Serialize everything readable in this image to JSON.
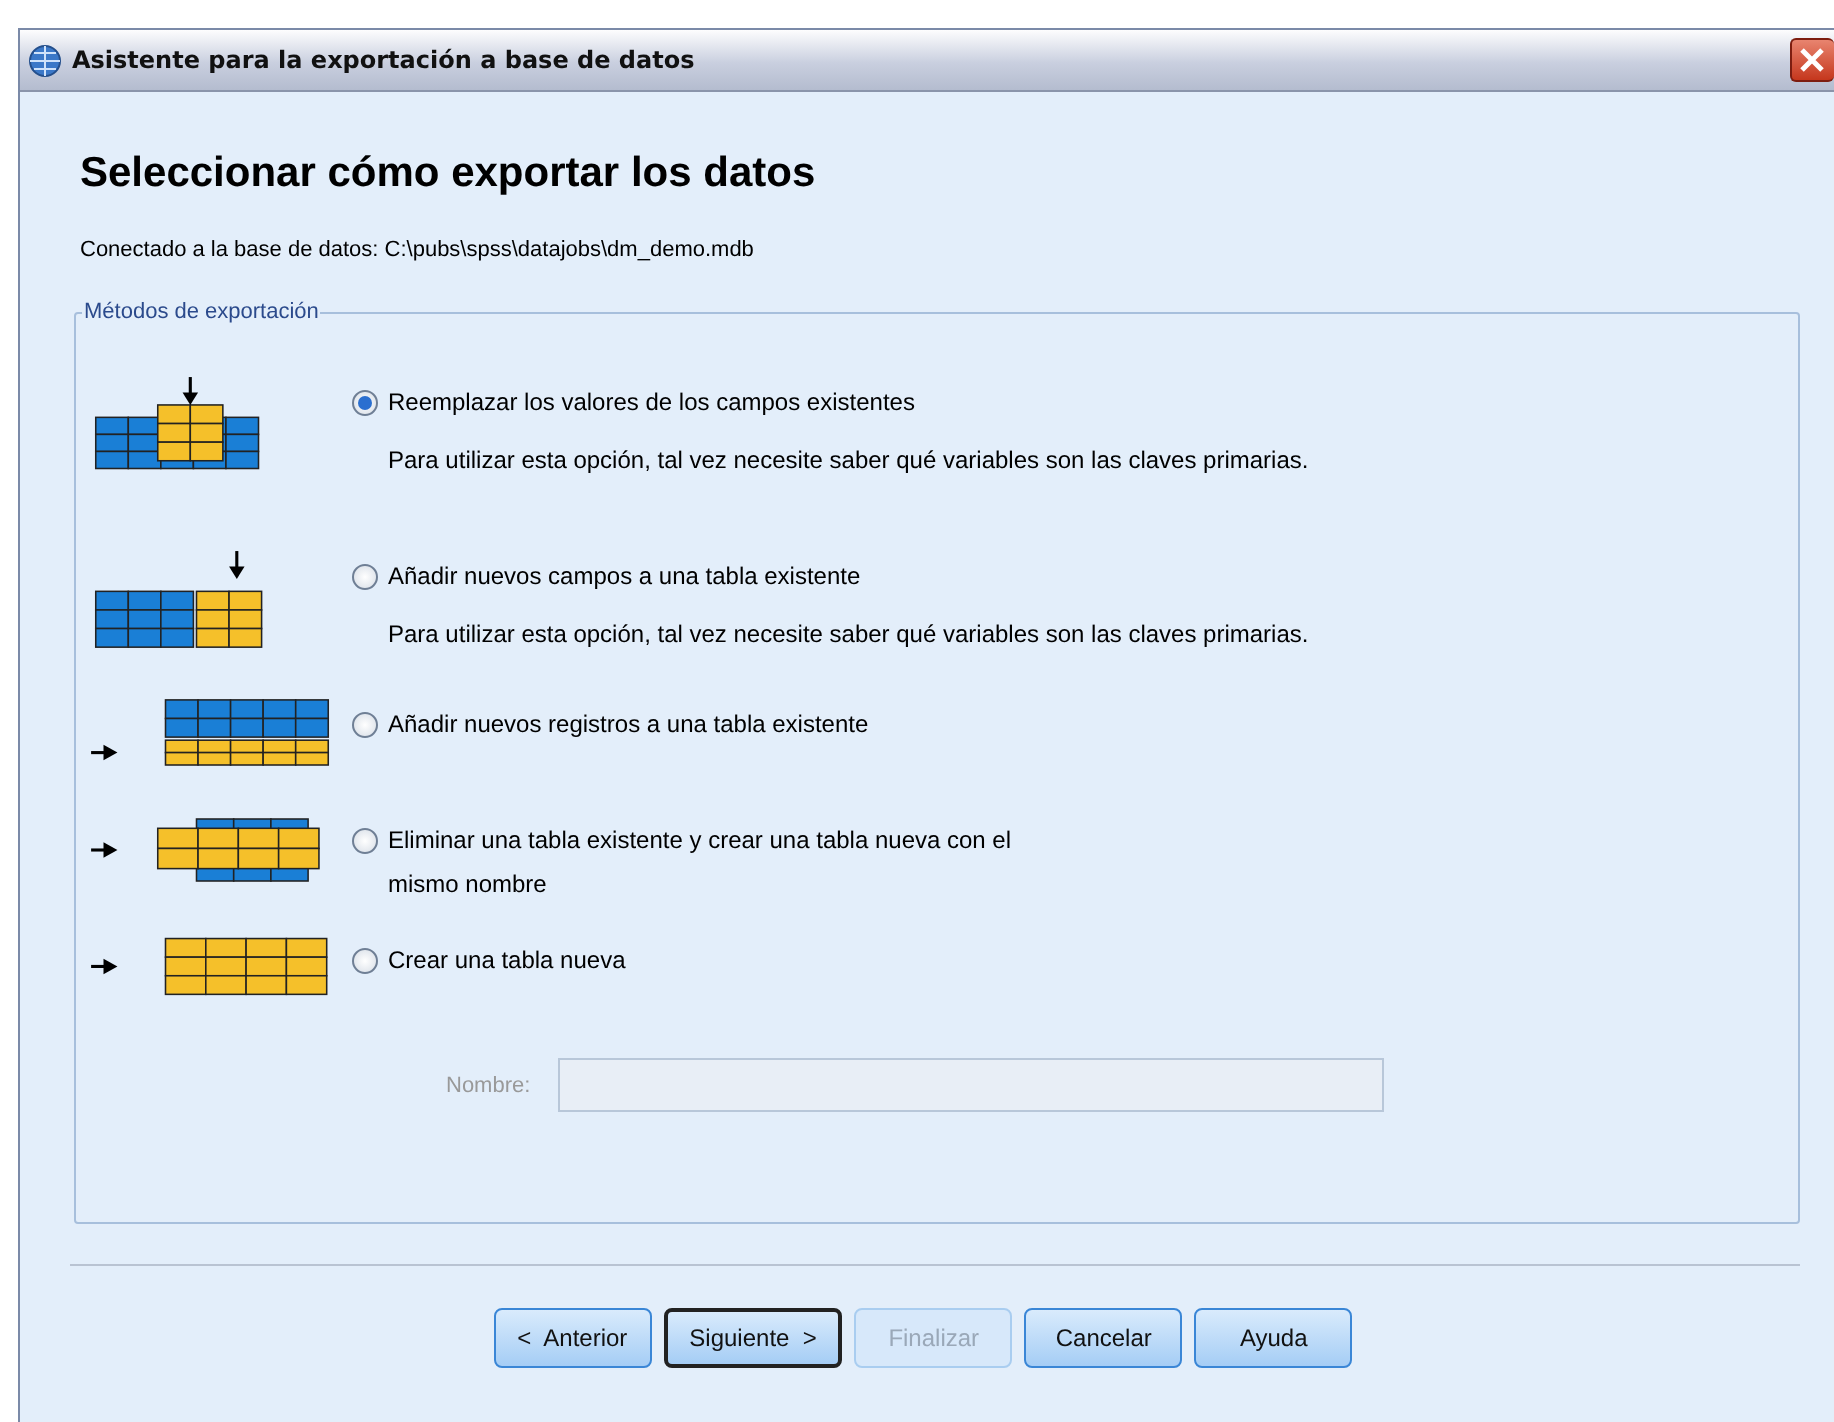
{
  "window": {
    "title": "Asistente para la exportación a base de datos"
  },
  "heading": "Seleccionar cómo exportar los datos",
  "connection": "Conectado a la base de datos: C:\\pubs\\spss\\datajobs\\dm_demo.mdb",
  "group": {
    "label": "Métodos de exportación",
    "options": [
      {
        "kind": "replace",
        "label": "Reemplazar los valores de los campos existentes",
        "note": "Para utilizar esta opción, tal vez necesite saber qué variables son las claves primarias.",
        "selected": true
      },
      {
        "kind": "add-fields",
        "label": "Añadir nuevos campos a una tabla existente",
        "note": "Para utilizar esta opción, tal vez necesite saber qué variables son las claves primarias.",
        "selected": false
      },
      {
        "kind": "add-records",
        "label": "Añadir nuevos registros a una tabla existente",
        "selected": false
      },
      {
        "kind": "drop-create",
        "label": "Eliminar una tabla existente y crear una tabla nueva con el mismo nombre",
        "selected": false
      },
      {
        "kind": "create",
        "label": "Crear una tabla nueva",
        "selected": false
      }
    ],
    "name_field": {
      "label": "Nombre:",
      "disabled": true
    }
  },
  "buttons": [
    {
      "label": "<  Anterior",
      "default": false,
      "disabled": false
    },
    {
      "label": "Siguiente  >",
      "default": true,
      "disabled": false
    },
    {
      "label": "Finalizar",
      "default": false,
      "disabled": true
    },
    {
      "label": "Cancelar",
      "default": false,
      "disabled": false
    },
    {
      "label": "Ayuda",
      "default": false,
      "disabled": false
    }
  ]
}
